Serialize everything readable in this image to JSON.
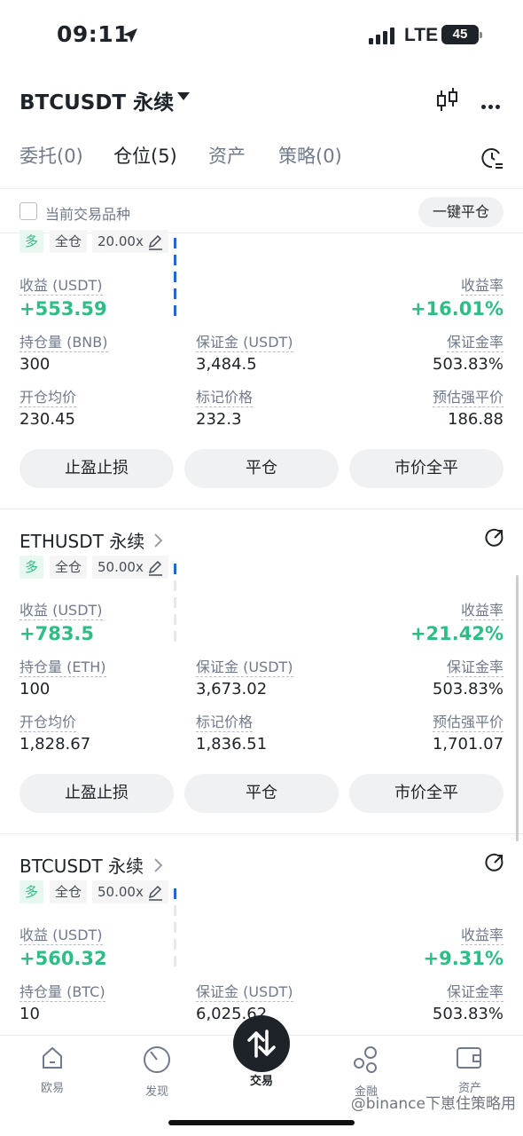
{
  "status_bar": {
    "time": "09:11",
    "network": "LTE",
    "battery": "45"
  },
  "header": {
    "symbol": "BTCUSDT 永续"
  },
  "tabs": [
    {
      "label": "委托(0)",
      "active": false
    },
    {
      "label": "仓位(5)",
      "active": true
    },
    {
      "label": "资产",
      "active": false
    },
    {
      "label": "策略(0)",
      "active": false
    }
  ],
  "filter": {
    "label": "当前交易品种",
    "close_all": "一键平仓"
  },
  "labels": {
    "pnl": "收益 (USDT)",
    "roe": "收益率",
    "margin": "保证金 (USDT)",
    "margin_ratio": "保证金率",
    "entry": "开仓均价",
    "mark": "标记价格",
    "liq": "预估强平价"
  },
  "buttons": {
    "tpsl": "止盈止损",
    "close": "平仓",
    "market_close": "市价全平"
  },
  "positions": [
    {
      "symbol": "",
      "side": "多",
      "margin_mode": "全仓",
      "leverage": "20.00x",
      "pnl": "+553.59",
      "roe": "+16.01%",
      "size_label": "持仓量 (BNB)",
      "size": "300",
      "margin": "3,484.5",
      "margin_ratio": "503.83%",
      "entry": "230.45",
      "mark": "232.3",
      "liq": "186.88"
    },
    {
      "symbol": "ETHUSDT 永续",
      "side": "多",
      "margin_mode": "全仓",
      "leverage": "50.00x",
      "pnl": "+783.5",
      "roe": "+21.42%",
      "size_label": "持仓量 (ETH)",
      "size": "100",
      "margin": "3,673.02",
      "margin_ratio": "503.83%",
      "entry": "1,828.67",
      "mark": "1,836.51",
      "liq": "1,701.07"
    },
    {
      "symbol": "BTCUSDT 永续",
      "side": "多",
      "margin_mode": "全仓",
      "leverage": "50.00x",
      "pnl": "+560.32",
      "roe": "+9.31%",
      "size_label": "持仓量 (BTC)",
      "size": "10",
      "margin": "6,025.62",
      "margin_ratio": "503.83%"
    }
  ],
  "bottom_nav": [
    {
      "label": "欧易",
      "icon": "home-icon"
    },
    {
      "label": "发现",
      "icon": "discover-icon"
    },
    {
      "label": "交易",
      "icon": "trade-icon",
      "active": true
    },
    {
      "label": "金融",
      "icon": "finance-icon"
    },
    {
      "label": "资产",
      "icon": "wallet-icon"
    }
  ],
  "watermark": "@binance下崽住策略用",
  "colors": {
    "profit": "#2ebd85",
    "adl": "#2166d4",
    "text": "#1e2329",
    "muted": "#707a8a"
  }
}
